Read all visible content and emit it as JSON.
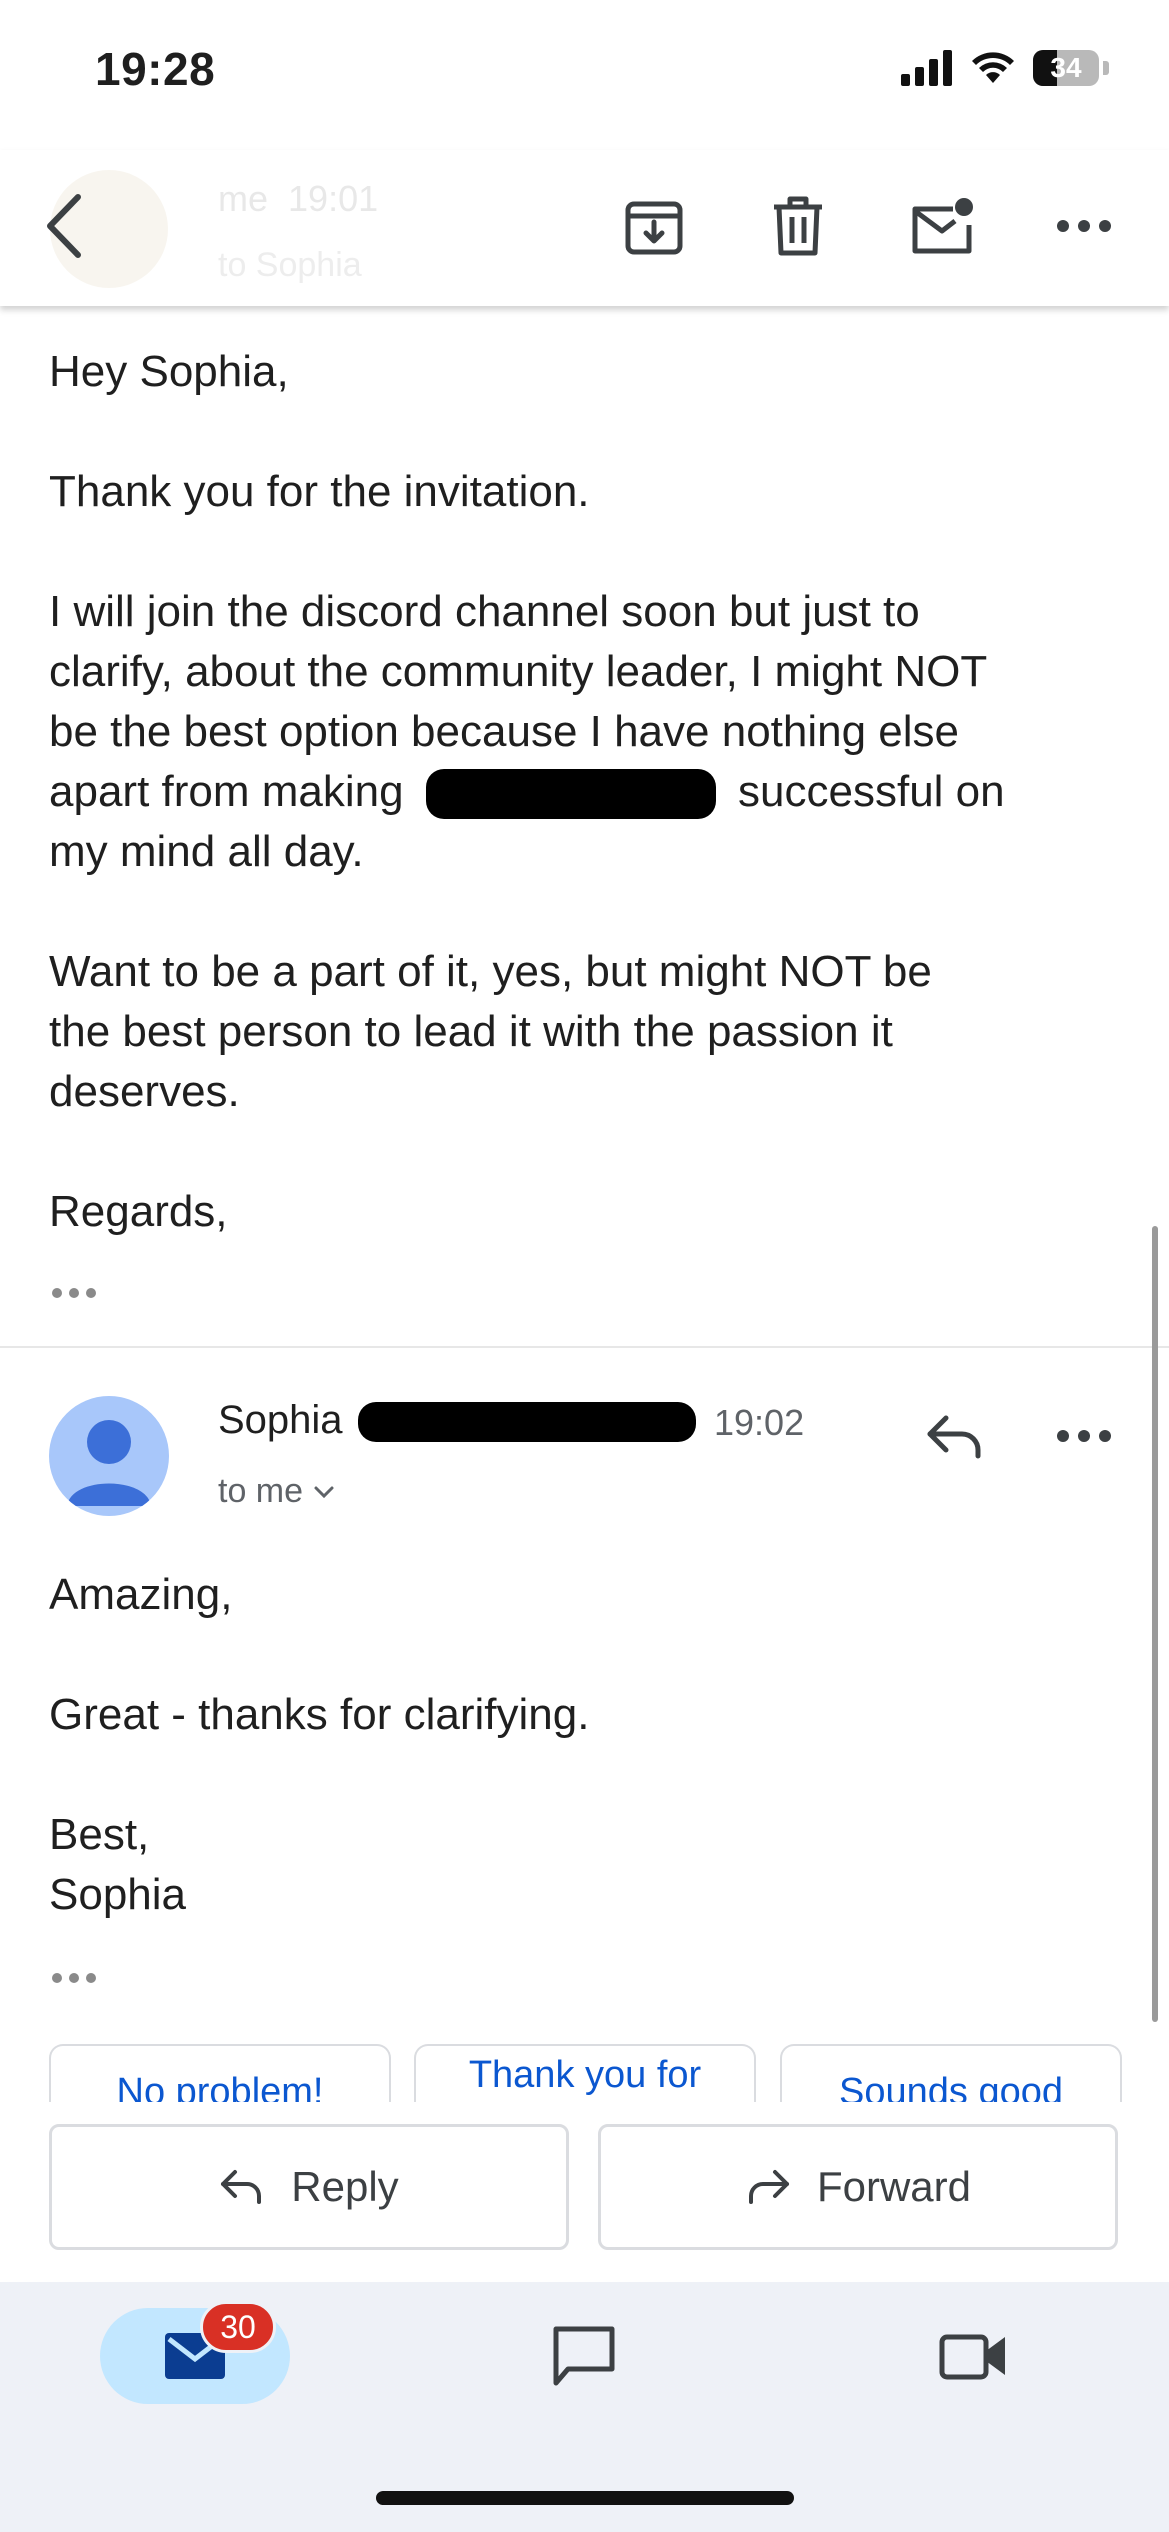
{
  "status_bar": {
    "time": "19:28",
    "battery": "34",
    "battery_level": 0.34
  },
  "toolbar": {
    "ghost_sender": "me",
    "ghost_time": "19:01",
    "ghost_recipient": "to Sophia",
    "icons": [
      "back-arrow-icon",
      "archive-icon",
      "trash-icon",
      "mark-unread-icon",
      "more-vert-icon"
    ]
  },
  "message1": {
    "greeting": "Hey Sophia,",
    "para1": "Thank you for the invitation.",
    "para2_line1": "I will join the discord channel soon but just to",
    "para2_line2": "clarify, about the community leader, I might NOT",
    "para2_line3": "be the best option because I have nothing else",
    "para2_line4_start": "apart from making",
    "para2_line4_end": "successful on",
    "para2_line5": "my mind all day.",
    "para3_line1": "Want to be a part of it, yes, but might NOT be",
    "para3_line2": "the best person to lead it with the passion it",
    "para3_line3": "deserves.",
    "signoff": "Regards,"
  },
  "message2": {
    "sender": "Sophia",
    "time": "19:02",
    "recipient": "to me",
    "greeting": "Amazing,",
    "body": "Great - thanks for clarifying.",
    "signoff": "Best,",
    "signature": "Sophia"
  },
  "smart_replies": [
    "No problem!",
    "Thank you for",
    "Sounds good"
  ],
  "actions": {
    "reply_label": "Reply",
    "forward_label": "Forward"
  },
  "bottom_nav": {
    "mail_badge": "30"
  },
  "colors": {
    "accent_blue": "#0b57d0",
    "badge_red": "#d93025",
    "pill_blue": "#c2e7ff",
    "avatar_blue": "#a8c7fa"
  }
}
